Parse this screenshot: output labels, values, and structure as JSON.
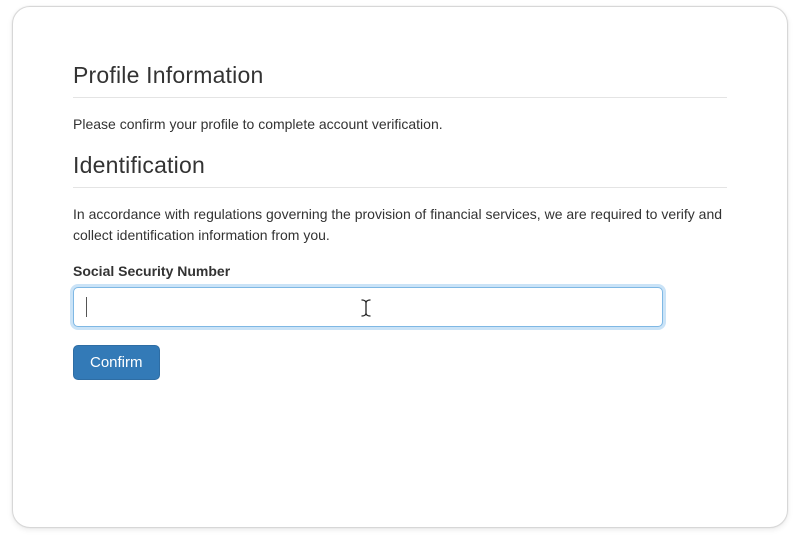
{
  "profile": {
    "heading": "Profile Information",
    "description": "Please confirm your profile to complete account verification."
  },
  "identification": {
    "heading": "Identification",
    "description": "In accordance with regulations governing the provision of financial services, we are required to verify and collect identification information from you.",
    "ssn_label": "Social Security Number",
    "ssn_value": "",
    "ssn_placeholder": ""
  },
  "actions": {
    "confirm_label": "Confirm"
  }
}
